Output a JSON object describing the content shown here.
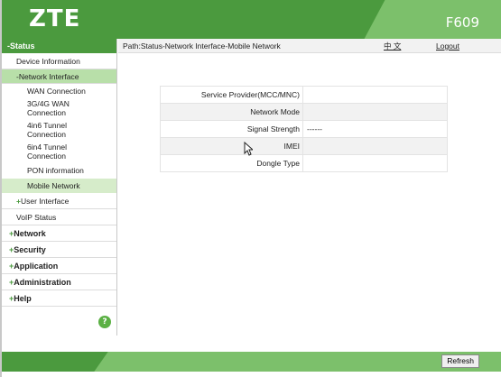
{
  "header": {
    "logo": "ZTE",
    "model": "F609"
  },
  "sidebar": {
    "status": "-Status",
    "device_information": "Device Information",
    "network_interface": "-Network Interface",
    "wan_connection": "WAN Connection",
    "wan_3g4g": "3G/4G WAN Connection",
    "tunnel_4in6": "4in6 Tunnel Connection",
    "tunnel_6in4": "6in4 Tunnel Connection",
    "pon_information": "PON information",
    "mobile_network": "Mobile Network",
    "user_interface": "User Interface",
    "voip_status": "VoIP Status",
    "network": "Network",
    "security": "Security",
    "application": "Application",
    "administration": "Administration",
    "help": "Help",
    "plus": "+",
    "help_icon_glyph": "?"
  },
  "pathbar": {
    "path": "Path:Status-Network Interface-Mobile Network",
    "language": "中 文",
    "logout": "Logout"
  },
  "info_table": {
    "rows": [
      {
        "label": "Service Provider(MCC/MNC)",
        "value": ""
      },
      {
        "label": "Network Mode",
        "value": ""
      },
      {
        "label": "Signal Strength",
        "value": "------"
      },
      {
        "label": "IMEI",
        "value": ""
      },
      {
        "label": "Dongle Type",
        "value": ""
      }
    ]
  },
  "footer": {
    "refresh_label": "Refresh"
  },
  "colors": {
    "brand_green": "#4b9a3e",
    "light_green": "#7cc06b",
    "active_bg": "#b8dfa9"
  }
}
